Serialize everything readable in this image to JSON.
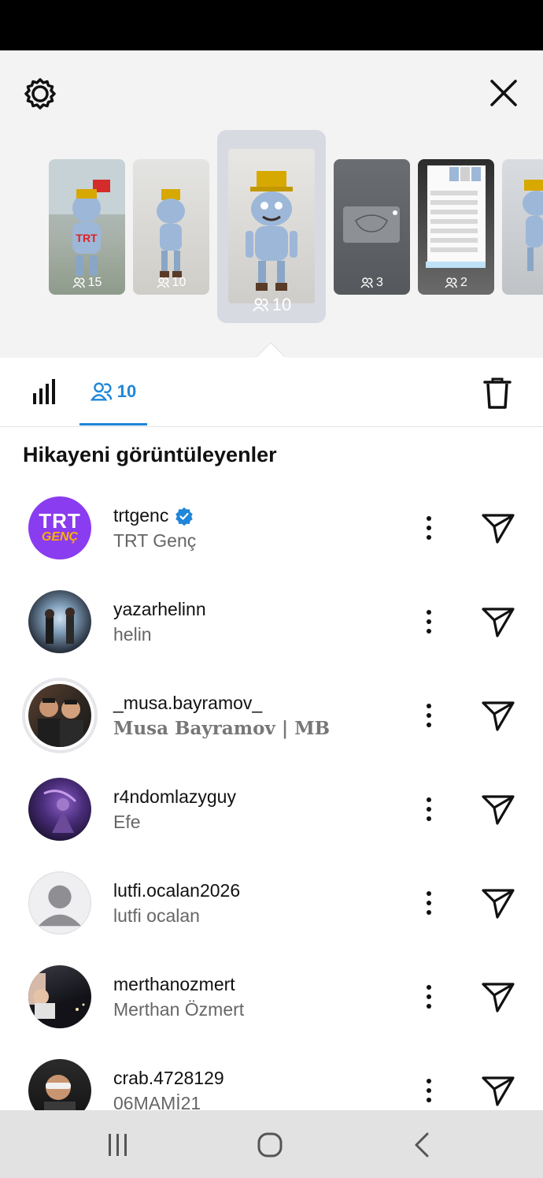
{
  "story_tray": {
    "thumbnails": [
      {
        "count": "15"
      },
      {
        "count": "10"
      },
      {
        "count": "10",
        "selected": true
      },
      {
        "count": "3"
      },
      {
        "count": "2"
      }
    ]
  },
  "tabs": {
    "viewers_count": "10"
  },
  "section_title": "Hikayeni görüntüleyenler",
  "viewers": [
    {
      "username": "trtgenc",
      "full_name": "TRT Genç",
      "verified": true,
      "avatar_text": "TRT",
      "avatar_subtext": "GENÇ"
    },
    {
      "username": "yazarhelinn",
      "full_name": "helin"
    },
    {
      "username": "_musa.bayramov_",
      "full_name": "Musa Bayramov | MB"
    },
    {
      "username": "r4ndomlazyguy",
      "full_name": "Efe"
    },
    {
      "username": "lutfi.ocalan2026",
      "full_name": "lutfi ocalan"
    },
    {
      "username": "merthanozmert",
      "full_name": "Merthan Özmert"
    },
    {
      "username": "crab.4728129",
      "full_name": "06MAMİ21"
    }
  ],
  "colors": {
    "accent": "#1f86d9",
    "verified": "#1f86d9",
    "trt_purple": "#8a3cf0"
  }
}
